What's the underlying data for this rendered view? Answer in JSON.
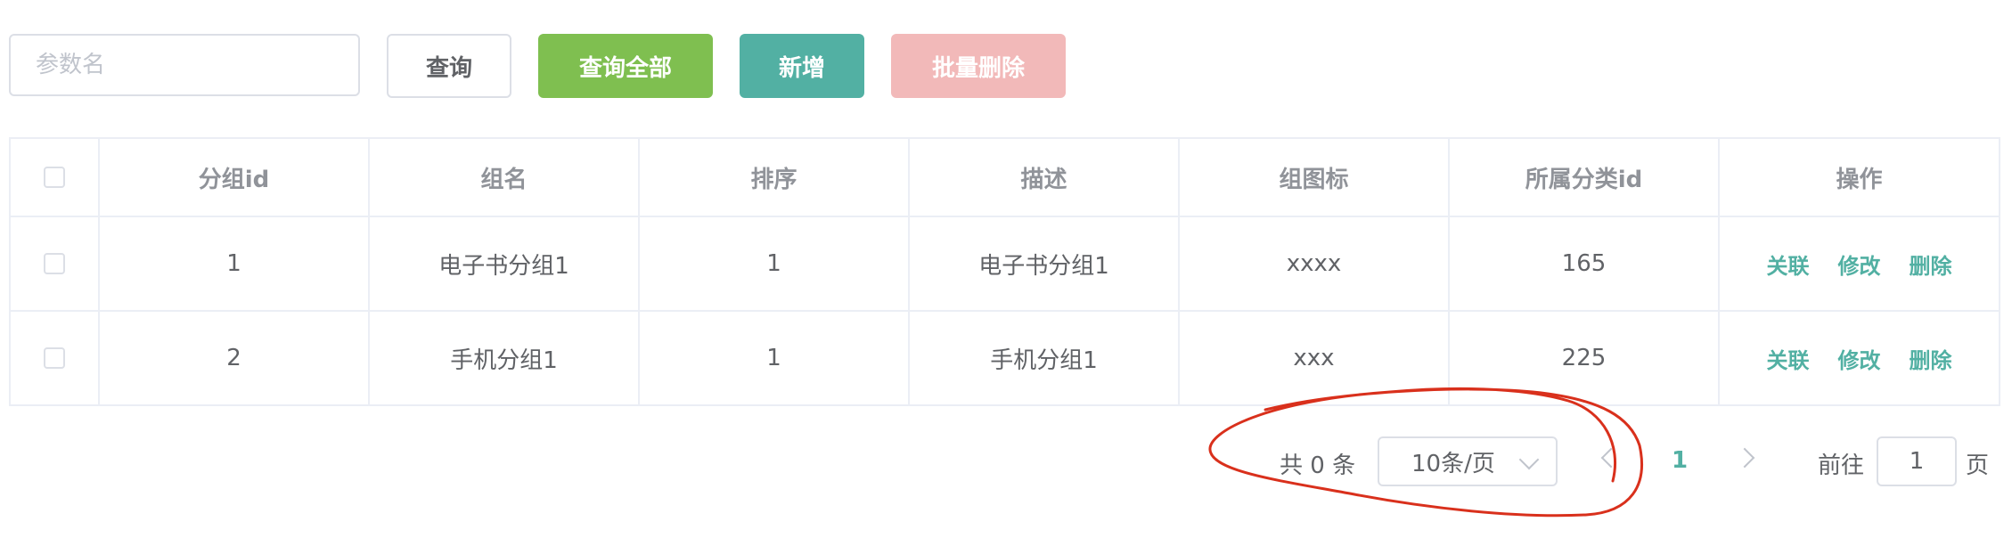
{
  "toolbar": {
    "search_placeholder": "参数名",
    "query_label": "查询",
    "query_all_label": "查询全部",
    "add_label": "新增",
    "batch_delete_label": "批量删除"
  },
  "table": {
    "columns": [
      "分组id",
      "组名",
      "排序",
      "描述",
      "组图标",
      "所属分类id",
      "操作"
    ],
    "rows": [
      {
        "id": "1",
        "name": "电子书分组1",
        "sort": "1",
        "desc": "电子书分组1",
        "icon": "xxxx",
        "catelog_id": "165"
      },
      {
        "id": "2",
        "name": "手机分组1",
        "sort": "1",
        "desc": "手机分组1",
        "icon": "xxx",
        "catelog_id": "225"
      }
    ],
    "actions": {
      "link": "关联",
      "edit": "修改",
      "delete": "删除"
    }
  },
  "pagination": {
    "total_text": "共 0 条",
    "page_size": "10条/页",
    "current_page": "1",
    "goto_label": "前往",
    "goto_value": "1",
    "page_unit": "页"
  },
  "colors": {
    "accent": "#52b0a3",
    "success": "#7fbf50",
    "danger_disabled": "#f2b9b9",
    "annotation": "#d9301c"
  }
}
